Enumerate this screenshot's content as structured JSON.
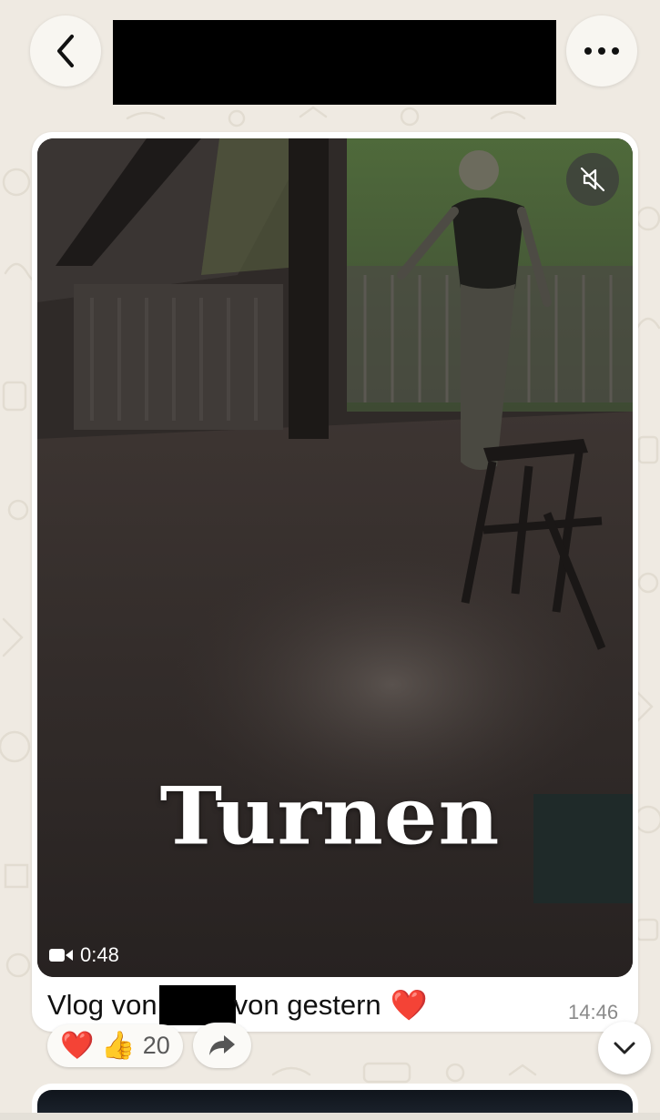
{
  "header": {
    "back_icon": "chevron-left-icon",
    "more_icon": "ellipsis-icon"
  },
  "message": {
    "video": {
      "overlay_text": "Turnen",
      "duration": "0:48",
      "mute_icon": "speaker-muted-icon",
      "camera_icon": "video-camera-icon"
    },
    "caption_prefix": "Vlog von",
    "caption_suffix": "von gestern",
    "caption_emoji": "❤️",
    "time": "14:46",
    "reactions": {
      "emojis": [
        "❤️",
        "👍"
      ],
      "count": "20"
    },
    "forward_icon": "forward-arrow-icon"
  },
  "scroll_down_icon": "chevron-down-icon",
  "colors": {
    "chat_background": "#efeae2",
    "bubble": "#ffffff",
    "timestamp": "#8a8a8a"
  }
}
